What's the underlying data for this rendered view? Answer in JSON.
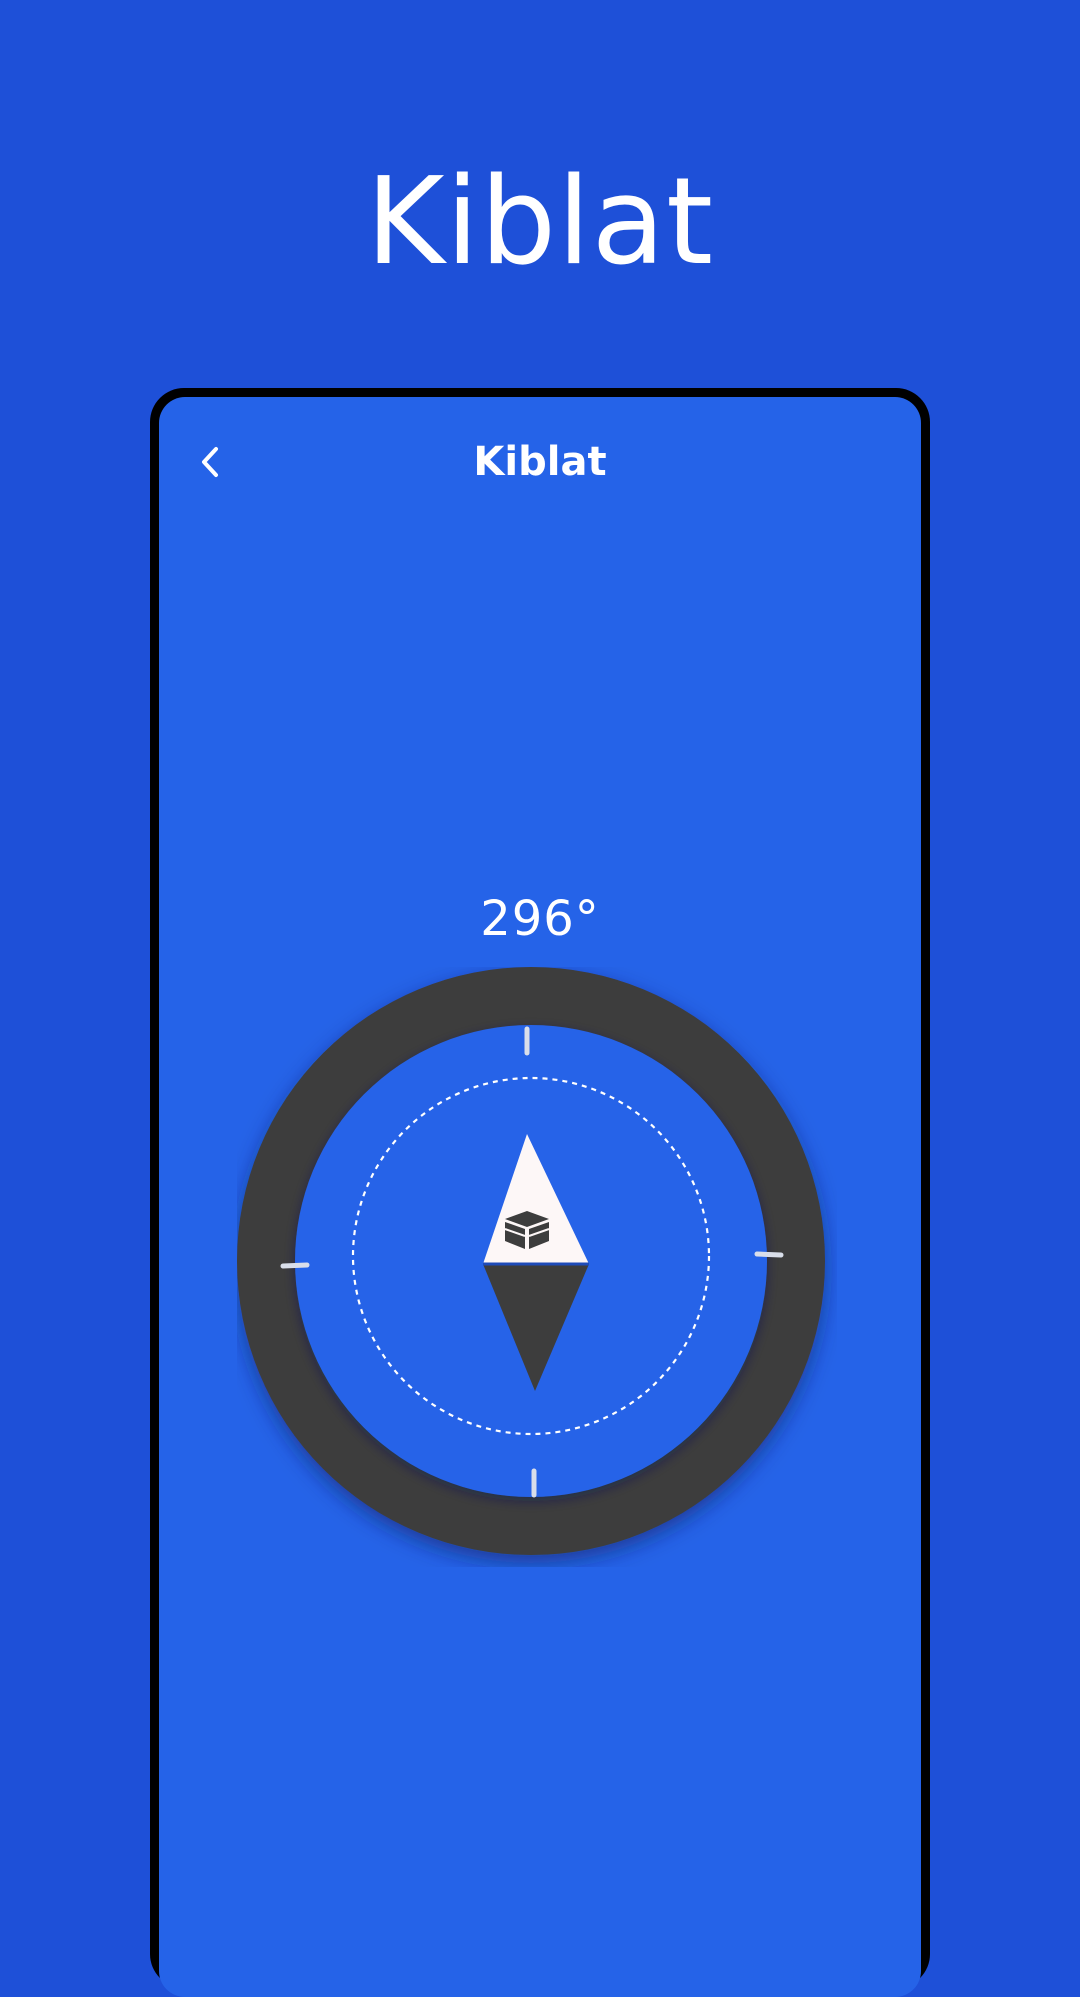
{
  "hero": {
    "title": "Kiblat"
  },
  "header": {
    "title": "Kiblat",
    "back_icon": "chevron-left-icon"
  },
  "compass": {
    "heading_text": "296°",
    "needle_icon": "kaaba-icon",
    "colors": {
      "background": "#1E50D8",
      "screen": "#2563E8",
      "ring": "#3D3D3D",
      "needle_north": "#FDF7F7",
      "needle_south": "#3D3D3D",
      "ticks": "#D9DEEA",
      "dashed_circle": "#FFFFFF"
    }
  }
}
